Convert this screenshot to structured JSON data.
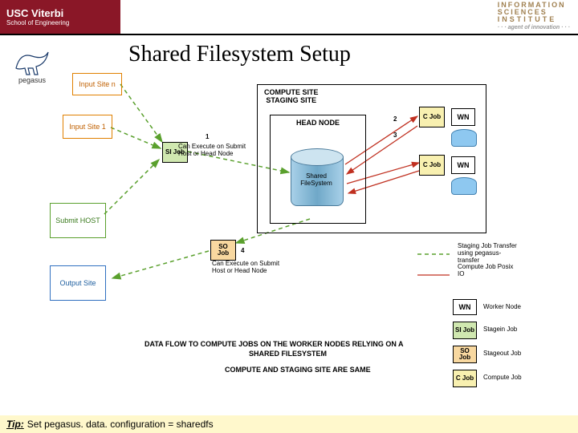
{
  "header": {
    "usc_top": "USC Viterbi",
    "usc_bottom": "School of Engineering",
    "isi_l1": "INFORMATION",
    "isi_l2": "SCIENCES",
    "isi_l3": "INSTITUTE",
    "isi_tag": "· · · agent of innovation · · ·"
  },
  "logo_label": "pegasus",
  "title": "Shared Filesystem Setup",
  "boxes": {
    "input_n": "Input  Site n",
    "input_1": "Input  Site 1",
    "submit_host": "Submit HOST",
    "output_site": "Output Site",
    "compute_site": "COMPUTE SITE\nSTAGING SITE",
    "head_node": "HEAD NODE"
  },
  "jobs": {
    "si": "SI\nJob",
    "so": "SO\nJob",
    "c": "C\nJob"
  },
  "wn": "WN",
  "shared_fs": "Shared\nFileSystem",
  "annotations": {
    "a1_num": "1",
    "a1_txt": "Can Execute on Submit\nHost or Head Node",
    "a2": "2",
    "a3": "3",
    "a4_num": "4",
    "a4_txt": "Can Execute on Submit\nHost or Head Node"
  },
  "caption_l1": "DATA FLOW TO COMPUTE JOBS ON THE WORKER NODES RELYING ON A",
  "caption_l2": "SHARED FILESYSTEM",
  "caption_l3": "COMPUTE AND STAGING SITE ARE SAME",
  "legend": {
    "staging": "Staging Job Transfer\nusing pegasus-\ntransfer\nCompute Job Posix\nIO",
    "wn": "Worker Node",
    "si": "Stagein Job",
    "so": "Stageout Job",
    "c": "Compute Job"
  },
  "tip_label": "Tip:",
  "tip_text": "Set pegasus. data. configuration = sharedfs",
  "colors": {
    "usc_crimson": "#8a1727",
    "arrow_green": "#5aa02d",
    "tip_bg": "#fff8cc"
  }
}
